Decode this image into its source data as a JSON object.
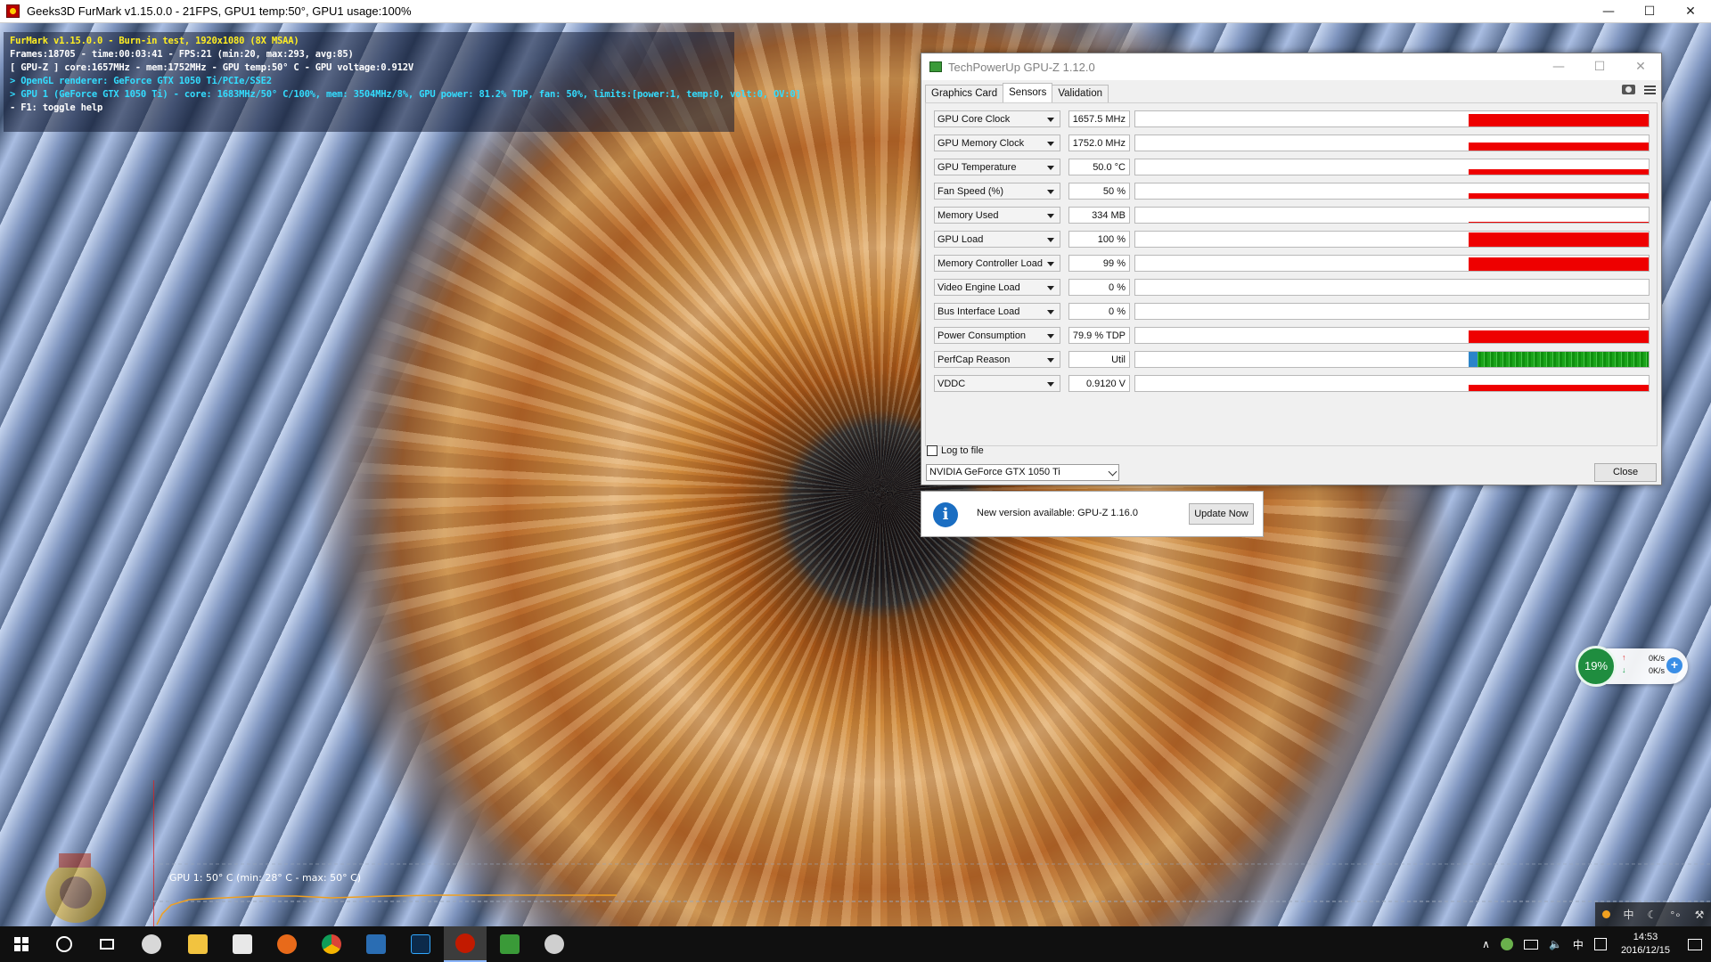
{
  "furmark": {
    "window_title": "Geeks3D FurMark v1.15.0.0 - 21FPS, GPU1 temp:50°, GPU1 usage:100%",
    "controls": {
      "minimize": "—",
      "maximize": "☐",
      "close": "✕"
    },
    "osd": {
      "line1": "FurMark v1.15.0.0 - Burn-in test, 1920x1080 (8X MSAA)",
      "line2": "Frames:18705 - time:00:03:41 - FPS:21 (min:20, max:293, avg:85)",
      "line3": "[ GPU-Z ] core:1657MHz - mem:1752MHz - GPU temp:50° C - GPU voltage:0.912V",
      "line4": "> OpenGL renderer: GeForce GTX 1050 Ti/PCIe/SSE2",
      "line5": "> GPU 1 (GeForce GTX 1050 Ti) - core: 1683MHz/50° C/100%, mem: 3504MHz/8%, GPU power: 81.2% TDP, fan: 50%, limits:[power:1, temp:0, volt:0, OV:0]",
      "line6": "- F1: toggle help"
    },
    "temp_graph_label": "GPU 1: 50° C (min: 28° C - max: 50° C)",
    "colors": {
      "osd_title": "#ffee22",
      "osd_info": "#33ddff",
      "temp_curve": "#f0a020"
    }
  },
  "gpuz": {
    "window_title": "TechPowerUp GPU-Z 1.12.0",
    "controls": {
      "minimize": "—",
      "maximize": "☐",
      "close": "✕"
    },
    "tabs": [
      {
        "label": "Graphics Card",
        "active": false
      },
      {
        "label": "Sensors",
        "active": true
      },
      {
        "label": "Validation",
        "active": false
      }
    ],
    "sensors": [
      {
        "name": "GPU Core Clock",
        "value": "1657.5 MHz",
        "level": 0.85
      },
      {
        "name": "GPU Memory Clock",
        "value": "1752.0 MHz",
        "level": 0.55
      },
      {
        "name": "GPU Temperature",
        "value": "50.0 °C",
        "level": 0.35
      },
      {
        "name": "Fan Speed (%)",
        "value": "50 %",
        "level": 0.35
      },
      {
        "name": "Memory Used",
        "value": "334 MB",
        "level": 0.05
      },
      {
        "name": "GPU Load",
        "value": "100 %",
        "level": 0.95
      },
      {
        "name": "Memory Controller Load",
        "value": "99 %",
        "level": 0.9
      },
      {
        "name": "Video Engine Load",
        "value": "0 %",
        "level": 0
      },
      {
        "name": "Bus Interface Load",
        "value": "0 %",
        "level": 0
      },
      {
        "name": "Power Consumption",
        "value": "79.9 % TDP",
        "level": 0.8
      },
      {
        "name": "PerfCap Reason",
        "value": "Util",
        "level": 1
      },
      {
        "name": "VDDC",
        "value": "0.9120 V",
        "level": 0.4
      }
    ],
    "log_label": "Log to file",
    "gpu_select": "NVIDIA GeForce GTX 1050 Ti",
    "close_label": "Close",
    "colors": {
      "sensor_graph": "#ee0000",
      "perfcap_graph": "#1aa31a"
    }
  },
  "update": {
    "text": "New version available: GPU-Z 1.16.0",
    "button": "Update Now",
    "icon": "info-icon"
  },
  "net_widget": {
    "cpu": "19%",
    "up": "0K/s",
    "down": "0K/s",
    "up_arrow": "↑",
    "down_arrow": "↓",
    "boost": "+"
  },
  "mini_tray": {
    "lang": "中",
    "moon": "☾",
    "dots": "°∘",
    "wrench": "⚒"
  },
  "taskbar": {
    "tray_lang": "中",
    "tray_up_arrow": "∧",
    "tray_volume": "🔈",
    "clock_time": "14:53",
    "clock_date": "2016/12/15"
  }
}
